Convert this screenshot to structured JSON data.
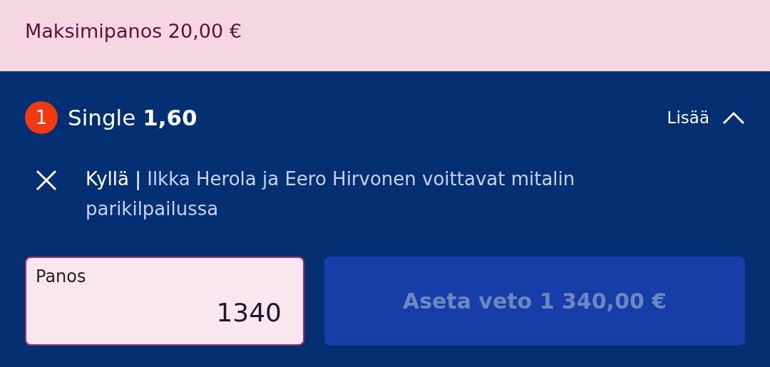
{
  "banner": {
    "text": "Maksimipanos 20,00 €"
  },
  "bet": {
    "count": "1",
    "type": "Single",
    "odds": "1,60",
    "more": "Lisää",
    "expanded": true
  },
  "selection": {
    "pick": "Kyllä |",
    "market": "Ilkka Herola ja Eero Hirvonen voittavat mitalin parikilpailussa"
  },
  "stake": {
    "label": "Panos",
    "value": "1340"
  },
  "place_button": {
    "label": "Aseta veto 1 340,00 €",
    "disabled": true
  }
}
